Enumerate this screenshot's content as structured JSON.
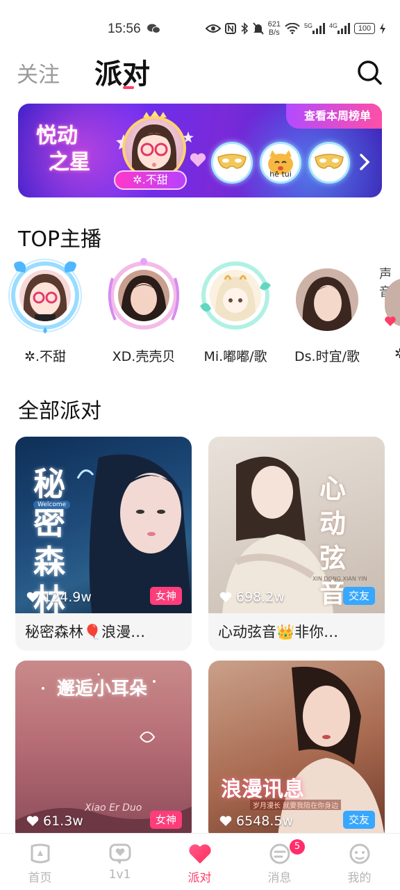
{
  "status": {
    "time": "15:56",
    "speed_value": "621",
    "speed_unit": "B/s",
    "net1": "5G",
    "net2": "4G",
    "battery": "100"
  },
  "header": {
    "tab_follow": "关注",
    "tab_party": "派对"
  },
  "banner": {
    "title_line1": "悦动",
    "title_line2": "之星",
    "rank_link": "查看本周榜单",
    "top_name": "✲.不甜",
    "mini2_label": "hē tui"
  },
  "top_section": {
    "title": "TOP主播"
  },
  "anchors": [
    {
      "name": "✲.不甜"
    },
    {
      "name": "XD.壳壳贝"
    },
    {
      "name": "Mi.嘟嘟/歌"
    },
    {
      "name": "Ds.时宜/歌"
    },
    {
      "name": "✲"
    }
  ],
  "partial_anchor_text": "声音",
  "party_section": {
    "title": "全部派对"
  },
  "parties": [
    {
      "caption": "秘密森林🎈浪漫…",
      "views": "124.9w",
      "tag": "女神",
      "cover_text": "秘密森林",
      "cover_sub": "Welcome",
      "accent": "#1c3b66"
    },
    {
      "caption": "心动弦音👑非你…",
      "views": "698.2w",
      "tag": "交友",
      "cover_text": "心动弦音",
      "cover_sub": "XIN DONG XIAN YIN",
      "accent": "#d9cfc6"
    },
    {
      "caption": "",
      "views": "61.3w",
      "tag": "女神",
      "cover_text": "邂逅小耳朵",
      "cover_sub": "Xiao Er Duo",
      "accent": "#b9747a"
    },
    {
      "caption": "",
      "views": "6548.5w",
      "tag": "交友",
      "cover_text": "浪漫讯息",
      "cover_sub": "岁月漫长 就要我陪在你身边",
      "accent": "#a05840"
    }
  ],
  "nav": [
    {
      "label": "首页",
      "icon": "home-icon"
    },
    {
      "label": "1v1",
      "icon": "chat-bubble-icon"
    },
    {
      "label": "派对",
      "icon": "heart-icon"
    },
    {
      "label": "消息",
      "icon": "message-icon",
      "badge": "5"
    },
    {
      "label": "我的",
      "icon": "profile-icon"
    }
  ],
  "colors": {
    "accent": "#ff3d66",
    "tag_pink": "#ff3d7a",
    "tag_blue": "#37a7ff"
  }
}
